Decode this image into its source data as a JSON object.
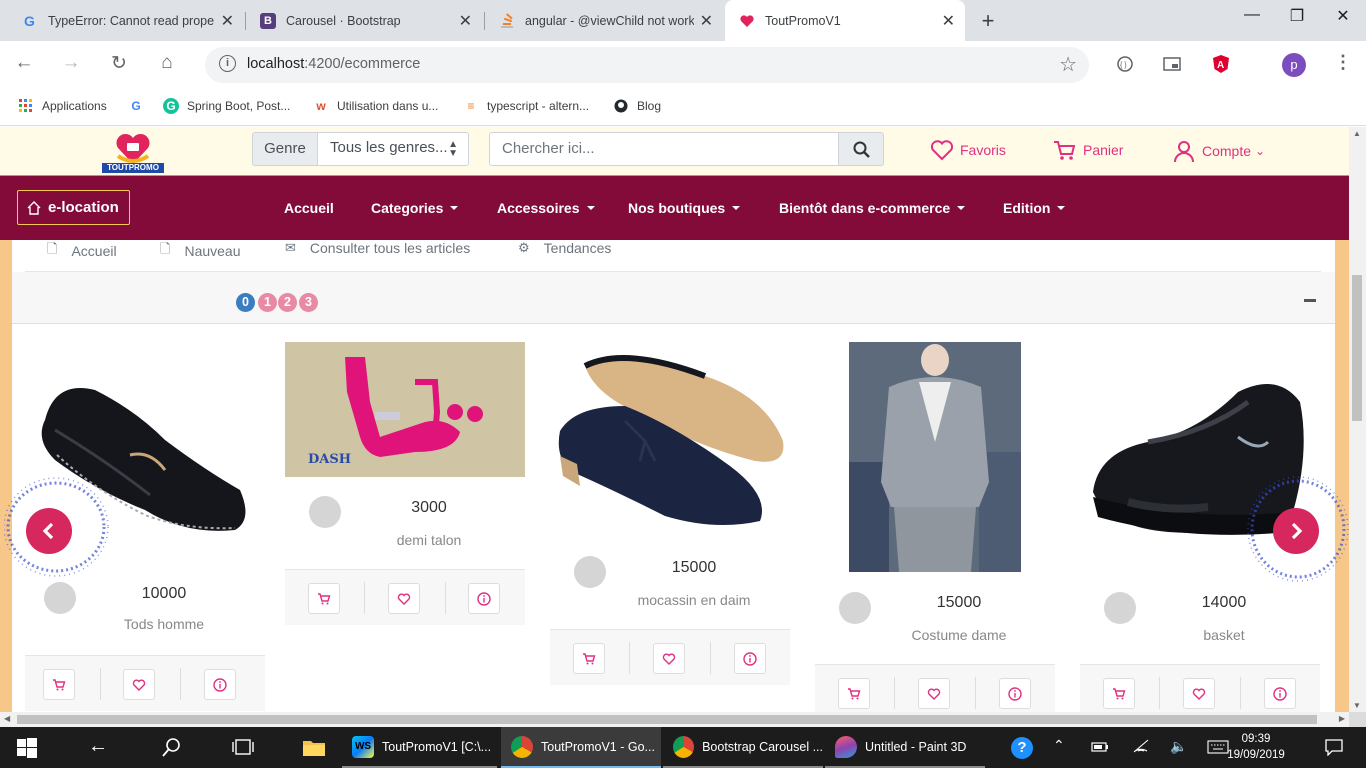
{
  "browser": {
    "tabs": [
      {
        "title": "TypeError: Cannot read proper",
        "icon": "google-icon",
        "active": false
      },
      {
        "title": "Carousel · Bootstrap",
        "icon": "bootstrap-icon",
        "active": false
      },
      {
        "title": "angular - @viewChild not work",
        "icon": "stackoverflow-icon",
        "active": false
      },
      {
        "title": "ToutPromoV1",
        "icon": "heart-icon",
        "active": true
      }
    ],
    "new_tab": "+",
    "window_controls": {
      "minimize": "—",
      "maximize": "❐",
      "close": "✕"
    },
    "url_host": "localhost",
    "url_rest": ":4200/ecommerce",
    "profile_initial": "p",
    "bookmarks": [
      {
        "label": "Applications",
        "icon": "apps-grid-icon"
      },
      {
        "label": "",
        "icon": "google-icon"
      },
      {
        "label": "Spring Boot, Post...",
        "icon": "grammarly-icon"
      },
      {
        "label": "Utilisation dans u...",
        "icon": "w-icon"
      },
      {
        "label": "typescript - altern...",
        "icon": "stackoverflow-icon"
      },
      {
        "label": "Blog",
        "icon": "github-icon"
      }
    ]
  },
  "site": {
    "logo_text": "TOUTPROMO",
    "genre_label": "Genre",
    "genre_select": "Tous les genres...",
    "search_placeholder": "Chercher ici...",
    "favoris": "Favoris",
    "panier": "Panier",
    "compte": "Compte",
    "brand": "e-location",
    "nav": [
      {
        "label": "Accueil",
        "dropdown": false
      },
      {
        "label": "Categories",
        "dropdown": true
      },
      {
        "label": "Accessoires",
        "dropdown": true
      },
      {
        "label": "Nos boutiques",
        "dropdown": true
      },
      {
        "label": "Bientôt dans e-commerce",
        "dropdown": true
      },
      {
        "label": "Edition",
        "dropdown": true
      }
    ],
    "subnav": [
      {
        "label": "Accueil",
        "icon": "file-icon"
      },
      {
        "label": "Nauveau",
        "icon": "file-icon"
      },
      {
        "label": "Consulter tous les articles",
        "icon": "mail-icon"
      },
      {
        "label": "Tendances",
        "icon": "gear-icon"
      }
    ],
    "indicators": [
      "0",
      "1",
      "2",
      "3"
    ],
    "active_indicator": 0,
    "products": [
      {
        "price": "10000",
        "name": "Tods homme"
      },
      {
        "price": "3000",
        "name": "demi talon",
        "image_caption": "DASH"
      },
      {
        "price": "15000",
        "name": "mocassin en daim"
      },
      {
        "price": "15000",
        "name": "Costume dame"
      },
      {
        "price": "14000",
        "name": "basket"
      }
    ],
    "colors": {
      "accent": "#820b3a",
      "pink": "#e03082",
      "arrow": "#d6275f",
      "indicator_active": "#3b7dc0",
      "indicator": "#e88aa6"
    }
  },
  "taskbar": {
    "apps": [
      {
        "label": "ToutPromoV1 [C:\\...",
        "icon": "webstorm-icon"
      },
      {
        "label": "ToutPromoV1 - Go...",
        "icon": "chrome-icon"
      },
      {
        "label": "Bootstrap Carousel ...",
        "icon": "chrome-icon"
      },
      {
        "label": "Untitled - Paint 3D",
        "icon": "paint3d-icon"
      }
    ],
    "time": "09:39",
    "date": "19/09/2019"
  }
}
